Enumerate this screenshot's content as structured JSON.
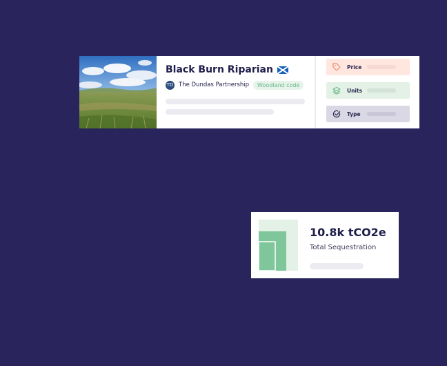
{
  "project": {
    "title": "Black Burn Riparian",
    "flag_icon": "scotland-flag-icon",
    "developer": "The Dundas Partnership",
    "developer_logo_text": "TD",
    "standard_badge": "Woodland code"
  },
  "attributes": [
    {
      "label": "Price",
      "icon": "tag-icon",
      "color": "#f08a6a"
    },
    {
      "label": "Units",
      "icon": "layers-icon",
      "color": "#6ab889"
    },
    {
      "label": "Type",
      "icon": "check-circle-icon",
      "color": "#2a2850"
    }
  ],
  "stats": {
    "value": "10.8k tCO2e",
    "caption": "Total Sequestration",
    "accent": "#7fc79a"
  }
}
